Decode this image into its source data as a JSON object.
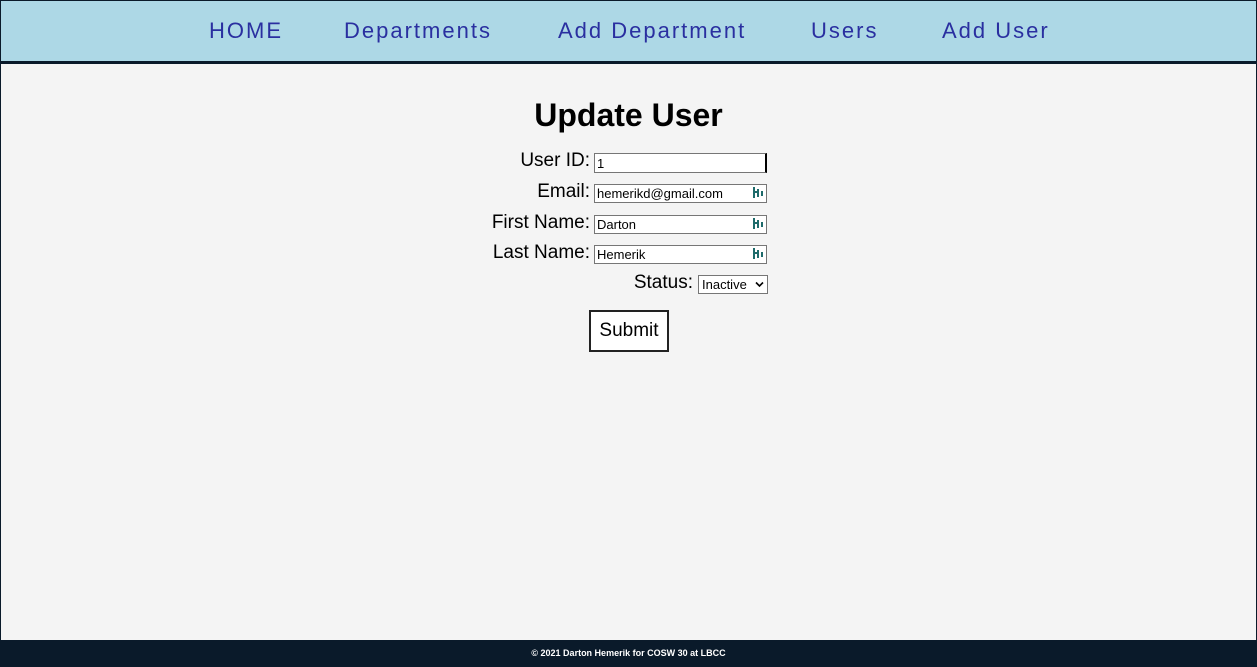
{
  "nav": {
    "items": [
      {
        "label": "HOME"
      },
      {
        "label": "Departments"
      },
      {
        "label": "Add Department"
      },
      {
        "label": "Users"
      },
      {
        "label": "Add User"
      }
    ]
  },
  "form": {
    "title": "Update User",
    "user_id": {
      "label": "User ID:",
      "value": "1"
    },
    "email": {
      "label": "Email:",
      "value": "hemerikd@gmail.com"
    },
    "first_name": {
      "label": "First Name:",
      "value": "Darton"
    },
    "last_name": {
      "label": "Last Name:",
      "value": "Hemerik"
    },
    "status": {
      "label": "Status:",
      "selected": "Inactive"
    },
    "submit_label": "Submit"
  },
  "footer": {
    "text": "© 2021 Darton Hemerik for COSW 30 at LBCC"
  },
  "colors": {
    "nav_bg": "#add8e6",
    "nav_link": "#2a2fa0",
    "page_bg": "#f4f4f4",
    "footer_bg": "#0a1a2a"
  },
  "icons": {
    "autofill": "password-manager-icon",
    "select": "chevron-down-icon"
  }
}
